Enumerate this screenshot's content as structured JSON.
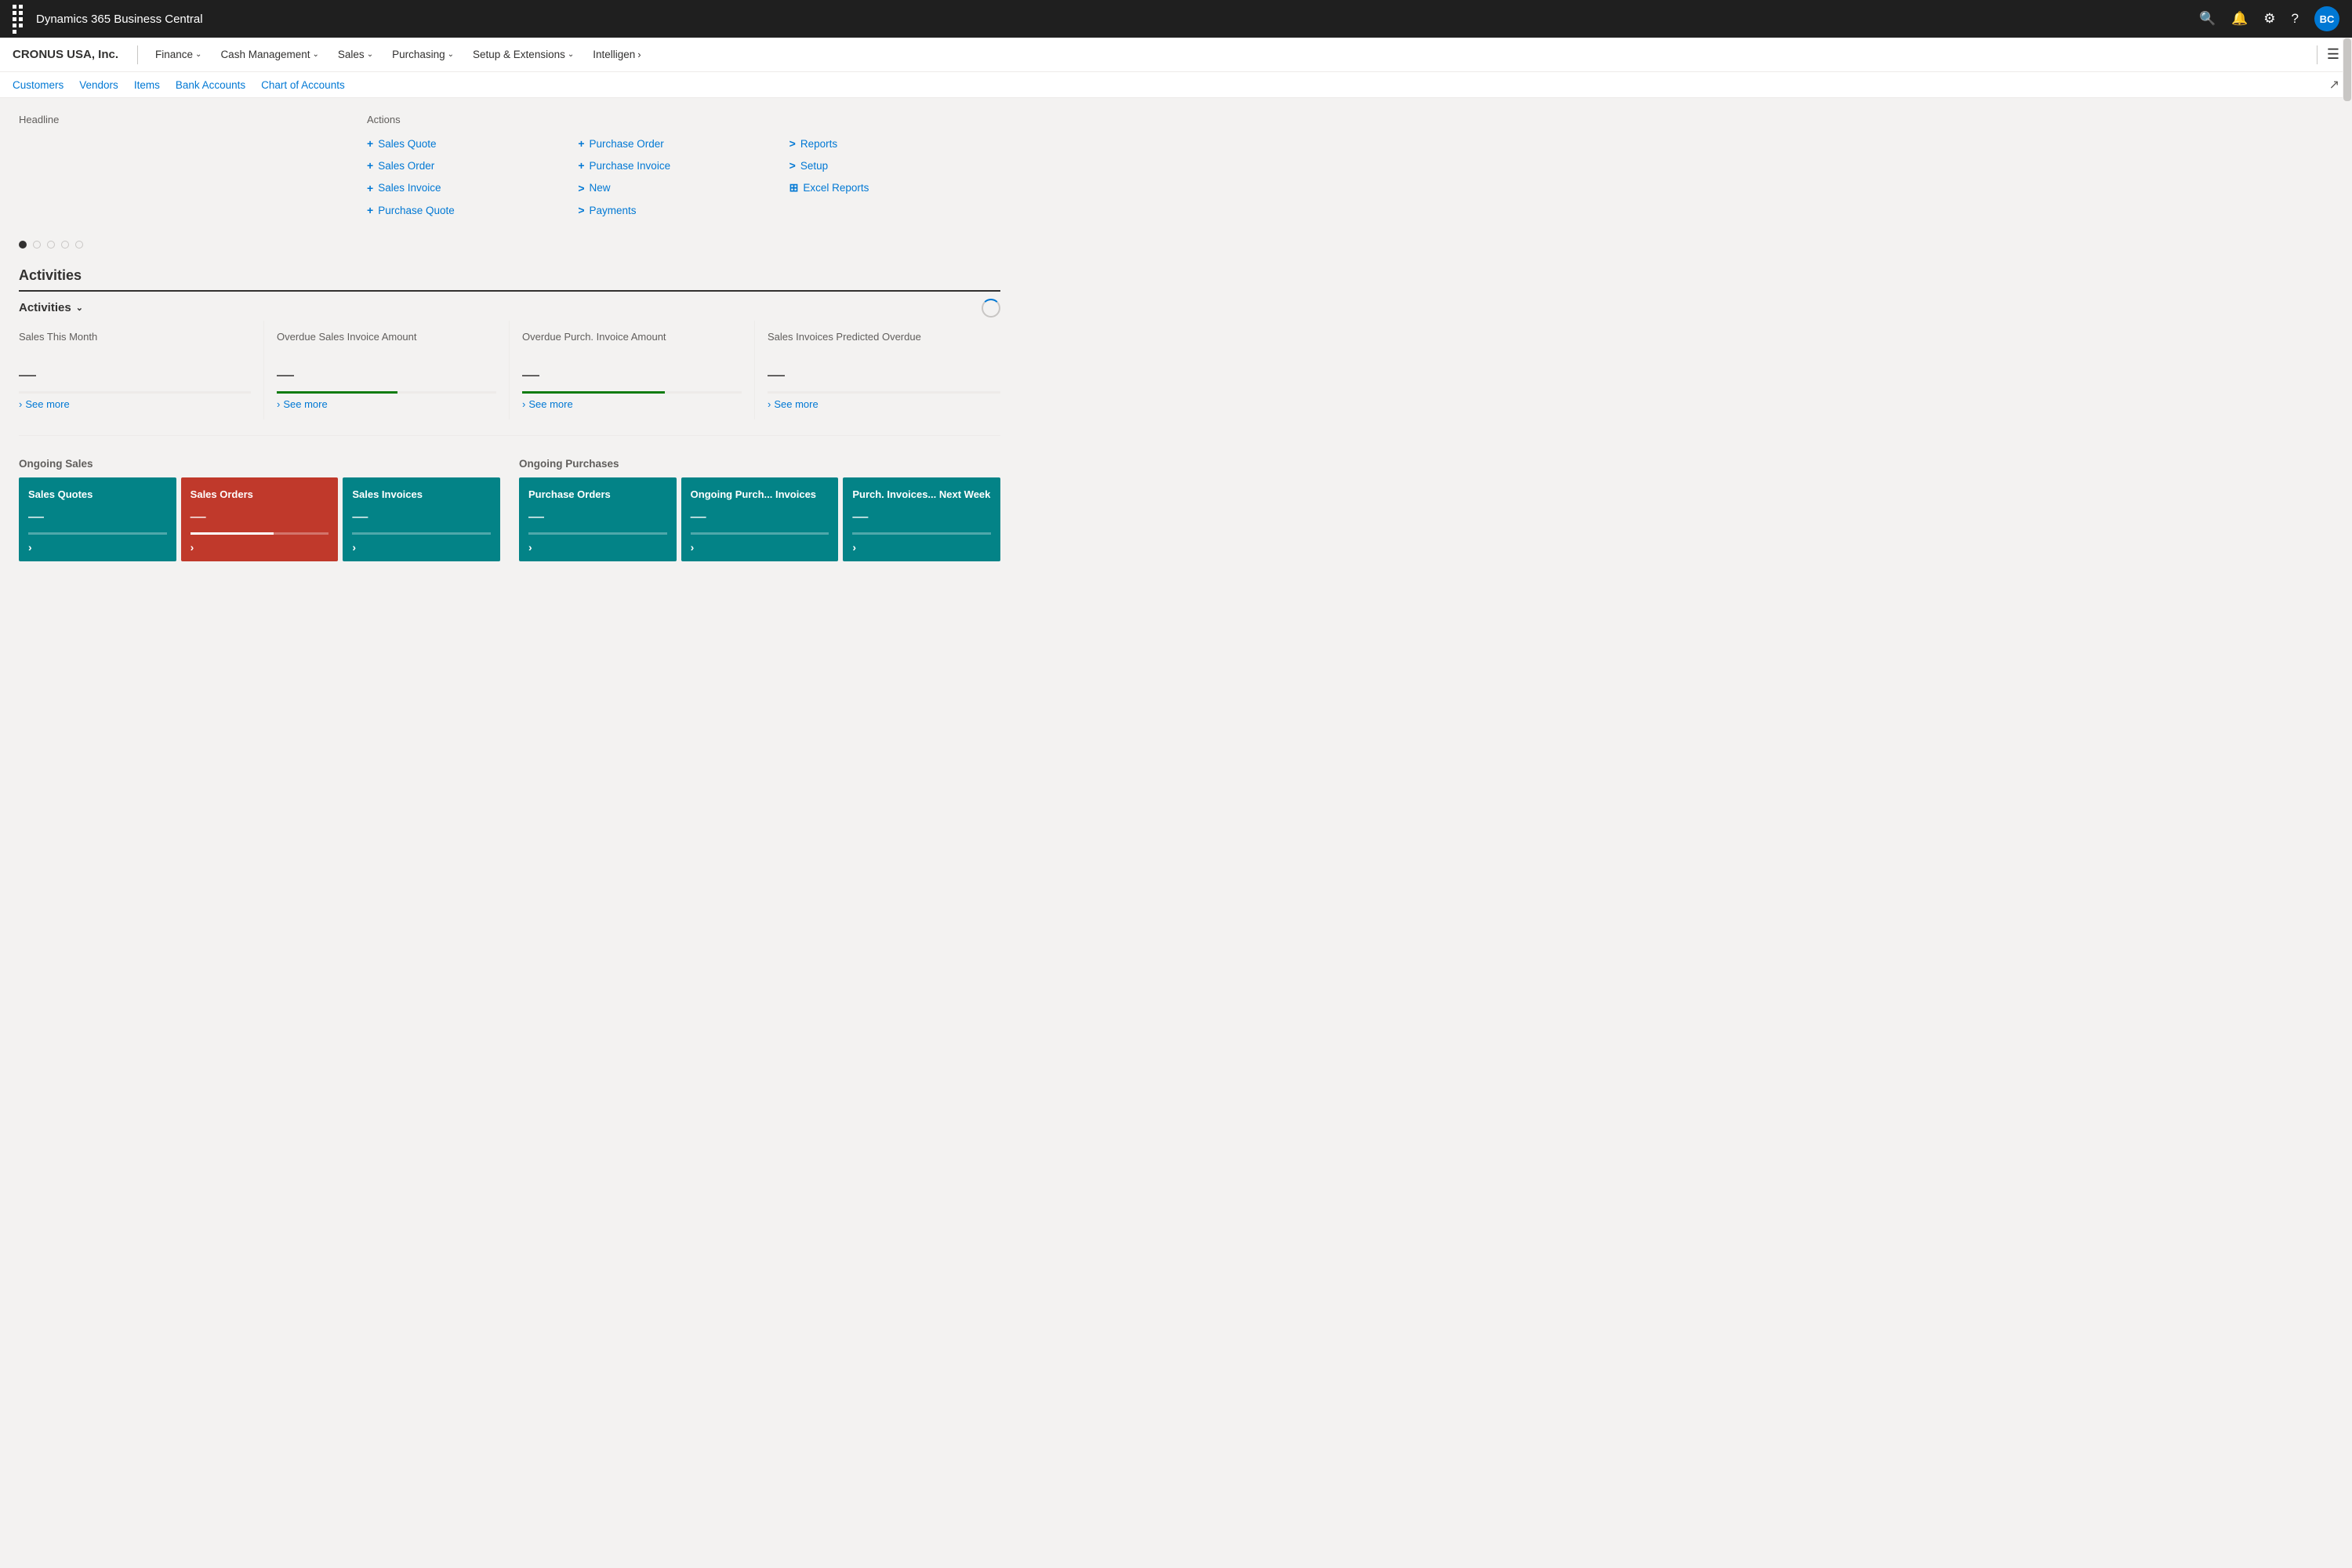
{
  "app": {
    "title": "Dynamics 365 Business Central",
    "avatar": "BC"
  },
  "menu": {
    "company": "CRONUS USA, Inc.",
    "nav_items": [
      {
        "label": "Finance",
        "has_dropdown": true
      },
      {
        "label": "Cash Management",
        "has_dropdown": true
      },
      {
        "label": "Sales",
        "has_dropdown": true
      },
      {
        "label": "Purchasing",
        "has_dropdown": true
      },
      {
        "label": "Setup & Extensions",
        "has_dropdown": true
      },
      {
        "label": "Intelligen",
        "has_more": true
      }
    ]
  },
  "sub_nav": {
    "links": [
      "Customers",
      "Vendors",
      "Items",
      "Bank Accounts",
      "Chart of Accounts"
    ]
  },
  "headline": {
    "label": "Headline"
  },
  "actions": {
    "label": "Actions",
    "items": [
      {
        "prefix": "+",
        "text": "Sales Quote"
      },
      {
        "prefix": "+",
        "text": "Purchase Order"
      },
      {
        "prefix": ">",
        "text": "Reports"
      },
      {
        "prefix": "+",
        "text": "Sales Order"
      },
      {
        "prefix": "+",
        "text": "Purchase Invoice"
      },
      {
        "prefix": ">",
        "text": "Setup"
      },
      {
        "prefix": "+",
        "text": "Sales Invoice"
      },
      {
        "prefix": ">",
        "text": "New"
      },
      {
        "prefix": "⊞",
        "text": "Excel Reports"
      },
      {
        "prefix": "+",
        "text": "Purchase Quote"
      },
      {
        "prefix": ">",
        "text": "Payments"
      }
    ]
  },
  "activities": {
    "section_title": "Activities",
    "group_label": "Activities",
    "cards": [
      {
        "label": "Sales This Month",
        "value": "—",
        "bar_fill": 0,
        "bar_color": "none",
        "see_more": "See more"
      },
      {
        "label": "Overdue Sales Invoice Amount",
        "value": "—",
        "bar_fill": 55,
        "bar_color": "green",
        "see_more": "See more"
      },
      {
        "label": "Overdue Purch. Invoice Amount",
        "value": "—",
        "bar_fill": 65,
        "bar_color": "green",
        "see_more": "See more"
      },
      {
        "label": "Sales Invoices Predicted Overdue",
        "value": "—",
        "bar_fill": 0,
        "bar_color": "none",
        "see_more": "See more"
      }
    ]
  },
  "ongoing_sales": {
    "title": "Ongoing Sales",
    "cards": [
      {
        "title": "Sales Quotes",
        "value": "—",
        "color": "teal"
      },
      {
        "title": "Sales Orders",
        "value": "—",
        "color": "red"
      },
      {
        "title": "Sales Invoices",
        "value": "—",
        "color": "teal"
      }
    ]
  },
  "ongoing_purchases": {
    "title": "Ongoing Purchases",
    "cards": [
      {
        "title": "Purchase Orders",
        "value": "—",
        "color": "teal"
      },
      {
        "title": "Ongoing Purch... Invoices",
        "value": "—",
        "color": "teal"
      },
      {
        "title": "Purch. Invoices... Next Week",
        "value": "—",
        "color": "teal"
      }
    ]
  },
  "dots": [
    true,
    false,
    false,
    false,
    false
  ]
}
